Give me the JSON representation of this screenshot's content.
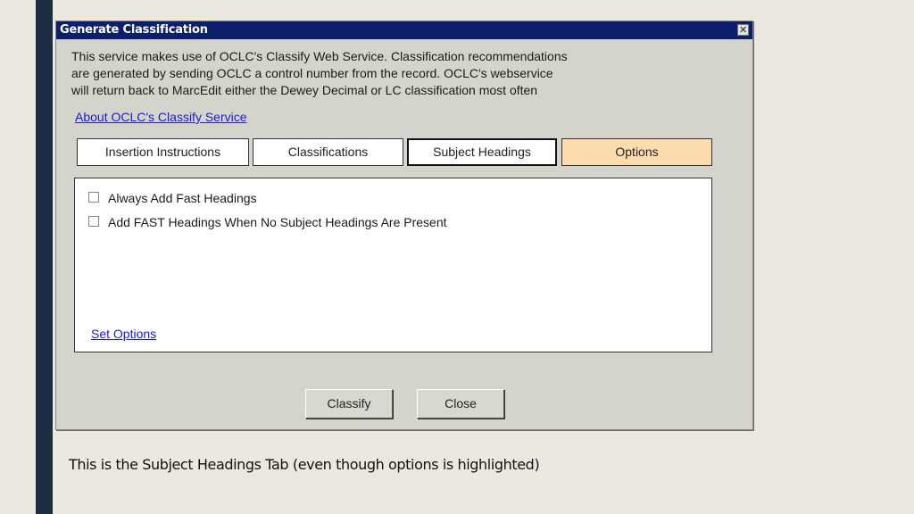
{
  "dialog": {
    "title": "Generate Classification",
    "close_icon": "close-icon",
    "description_lines": [
      "This service makes use of OCLC's Classify Web Service.  Classification recommendations",
      "are generated by sending OCLC a control number from the record.  OCLC's webservice",
      "will return back to MarcEdit either the Dewey Decimal or LC classification most often"
    ],
    "about_link": "About OCLC's Classify Service",
    "tabs": [
      {
        "label": "Insertion Instructions",
        "state": "normal"
      },
      {
        "label": "Classifications",
        "state": "normal"
      },
      {
        "label": "Subject Headings",
        "state": "selected"
      },
      {
        "label": "Options",
        "state": "highlighted"
      }
    ],
    "options": [
      {
        "label": "Always Add Fast Headings",
        "checked": false
      },
      {
        "label": "Add FAST Headings When No Subject Headings Are Present",
        "checked": false
      }
    ],
    "set_options_link": "Set Options",
    "buttons": {
      "classify": "Classify",
      "close": "Close"
    }
  },
  "caption": "This is the Subject Headings Tab (even though options is highlighted)",
  "colors": {
    "titlebar": "#0d1f6b",
    "options_tab_highlight": "#fcdcae",
    "link": "#1a1ad6",
    "side_bar": "#1c2d42"
  }
}
